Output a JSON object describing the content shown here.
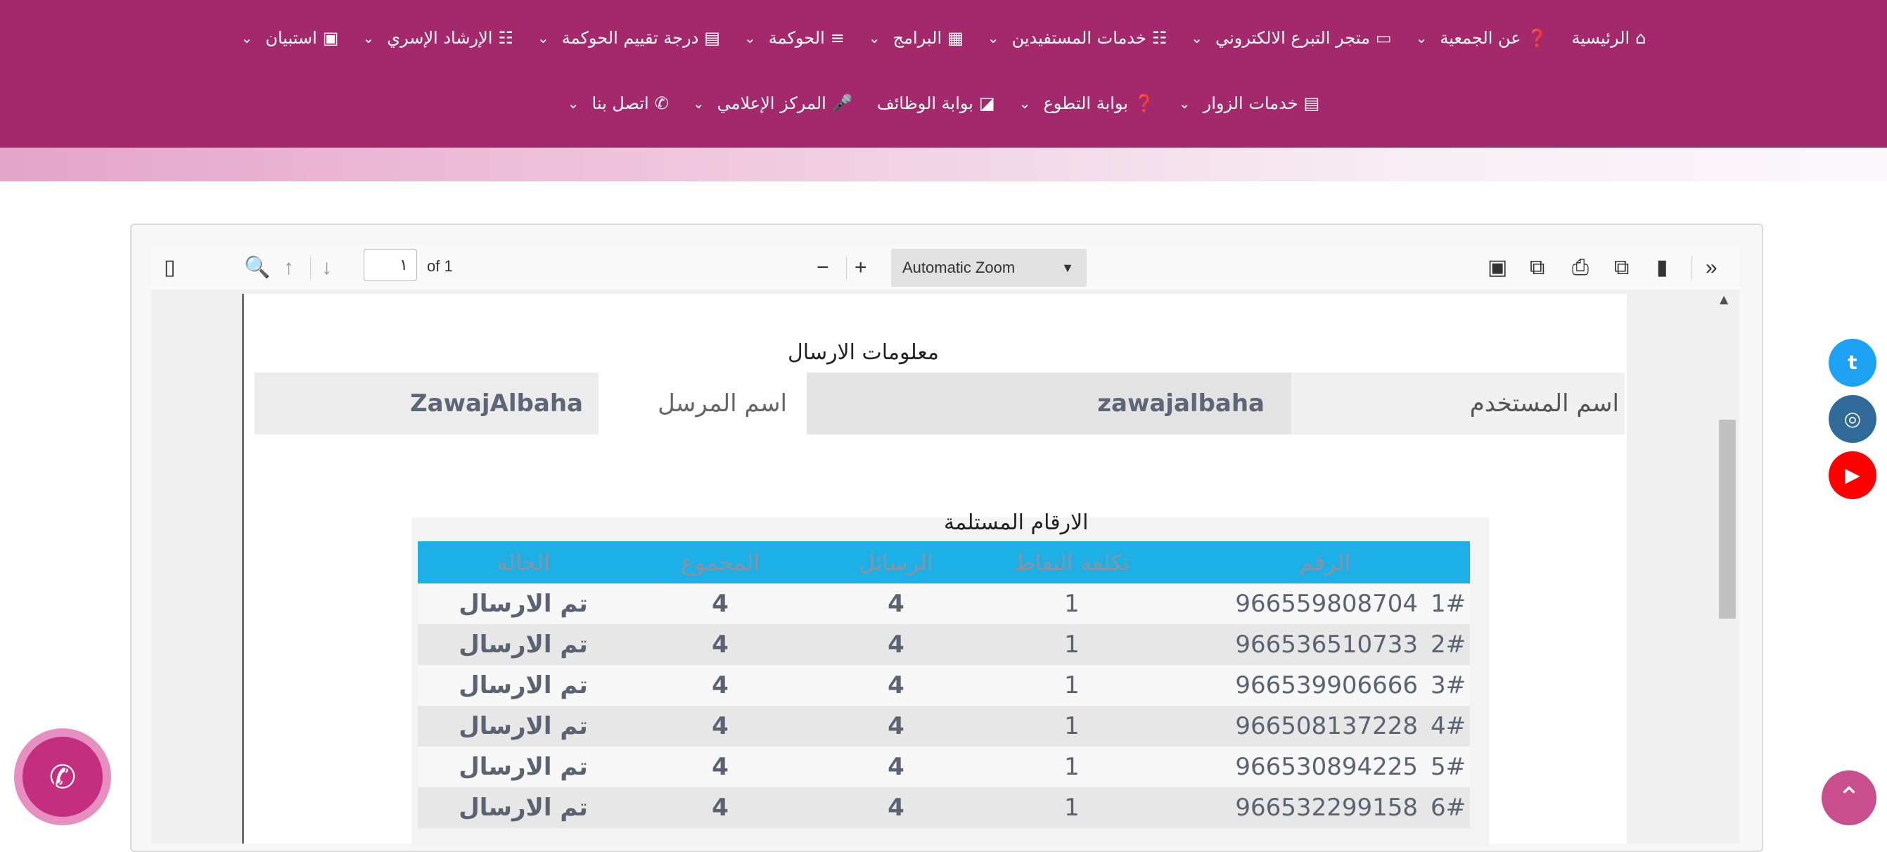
{
  "nav": {
    "row1": [
      {
        "icon": "⌂",
        "label": "الرئيسية"
      },
      {
        "icon": "❓",
        "label": "عن الجمعية"
      },
      {
        "icon": "▭",
        "label": "متجر التبرع الالكتروني"
      },
      {
        "icon": "☷",
        "label": "خدمات المستفيدين"
      },
      {
        "icon": "▦",
        "label": "البرامج"
      },
      {
        "icon": "≡",
        "label": "الحوكمة"
      },
      {
        "icon": "▤",
        "label": "درجة تقييم الحوكمة"
      },
      {
        "icon": "☷",
        "label": "الإرشاد الإسري"
      },
      {
        "icon": "▣",
        "label": "استبيان"
      }
    ],
    "row2": [
      {
        "icon": "▤",
        "label": "خدمات الزوار"
      },
      {
        "icon": "❓",
        "label": "بوابة التطوع"
      },
      {
        "icon": "◪",
        "label": "بوابة الوظائف"
      },
      {
        "icon": "🎤",
        "label": "المركز الإعلامي"
      },
      {
        "icon": "✆",
        "label": "اتصل بنا"
      }
    ],
    "chevron": "⌄"
  },
  "viewer": {
    "page_value": "١",
    "page_of": "of 1",
    "zoom": "Automatic Zoom"
  },
  "document": {
    "send_info_title": "معلومات الارسال",
    "username_label": "اسم المستخدم",
    "username": "zawajalbaha",
    "sender_label": "اسم المرسل",
    "sender": "ZawajAlbaha",
    "numbers_title": "الارقام المستلمة",
    "headers": {
      "number": "الرقم",
      "cost": "تكلفة النقاط",
      "messages": "الرسائل",
      "total": "المجموع",
      "status": "الحالة"
    },
    "rows": [
      {
        "idx": "1#",
        "number": "966559808704",
        "cost": "1",
        "messages": "4",
        "total": "4",
        "status": "تم الارسال"
      },
      {
        "idx": "2#",
        "number": "966536510733",
        "cost": "1",
        "messages": "4",
        "total": "4",
        "status": "تم الارسال"
      },
      {
        "idx": "3#",
        "number": "966539906666",
        "cost": "1",
        "messages": "4",
        "total": "4",
        "status": "تم الارسال"
      },
      {
        "idx": "4#",
        "number": "966508137228",
        "cost": "1",
        "messages": "4",
        "total": "4",
        "status": "تم الارسال"
      },
      {
        "idx": "5#",
        "number": "966530894225",
        "cost": "1",
        "messages": "4",
        "total": "4",
        "status": "تم الارسال"
      },
      {
        "idx": "6#",
        "number": "966532299158",
        "cost": "1",
        "messages": "4",
        "total": "4",
        "status": "تم الارسال"
      }
    ]
  },
  "colors": {
    "brand": "#a3296c",
    "table_header": "#1cb0e6",
    "whatsapp": "#c42e7f"
  }
}
